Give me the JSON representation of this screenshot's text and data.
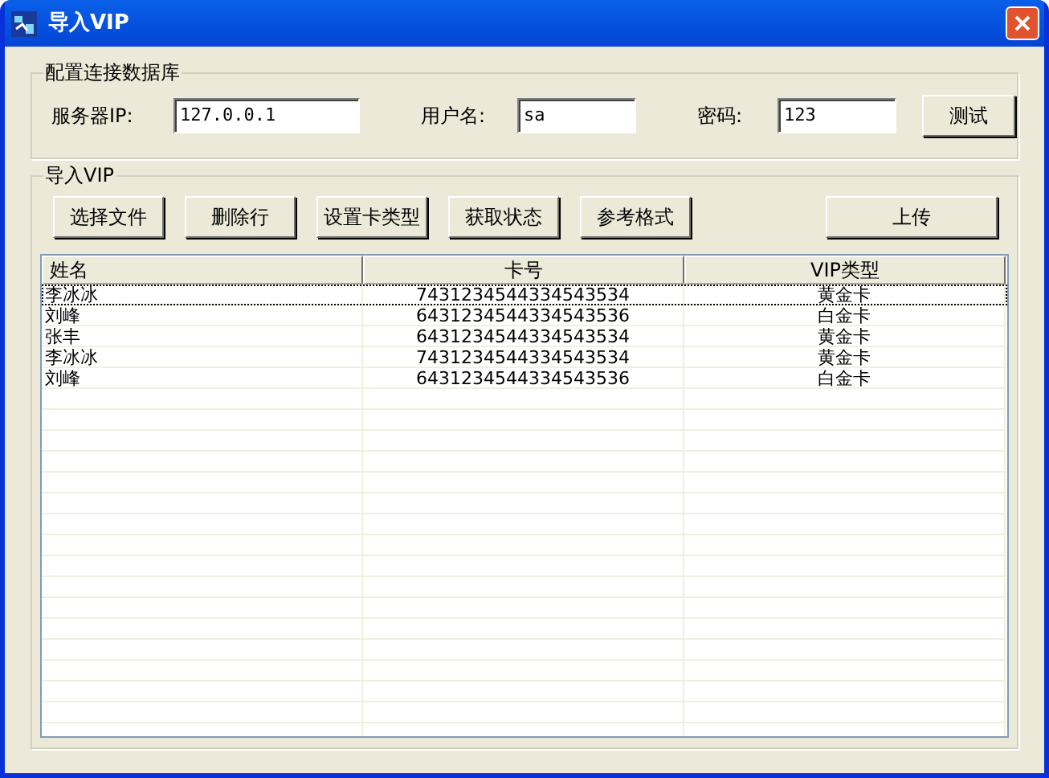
{
  "window": {
    "title": "导入VIP"
  },
  "db_group": {
    "title": "配置连接数据库",
    "fields": [
      {
        "label": "服务器IP:",
        "value": "127.0.0.1"
      },
      {
        "label": "用户名:",
        "value": "sa"
      },
      {
        "label": "密码:",
        "value": "123"
      }
    ],
    "test_button": "测试"
  },
  "import_group": {
    "title": "导入VIP",
    "buttons": [
      "选择文件",
      "删除行",
      "设置卡类型",
      "获取状态",
      "参考格式"
    ],
    "upload_button": "上传",
    "table": {
      "columns": [
        "姓名",
        "卡号",
        "VIP类型"
      ],
      "rows": [
        {
          "cells": [
            "李冰冰",
            "7431234544334543534",
            "黄金卡"
          ],
          "focused": true
        },
        {
          "cells": [
            "刘峰",
            "6431234544334543536",
            "白金卡"
          ],
          "focused": false
        },
        {
          "cells": [
            "张丰",
            "6431234544334543534",
            "黄金卡"
          ],
          "focused": false
        },
        {
          "cells": [
            "李冰冰",
            "7431234544334543534",
            "黄金卡"
          ],
          "focused": false
        },
        {
          "cells": [
            "刘峰",
            "6431234544334543536",
            "白金卡"
          ],
          "focused": false
        }
      ]
    }
  }
}
